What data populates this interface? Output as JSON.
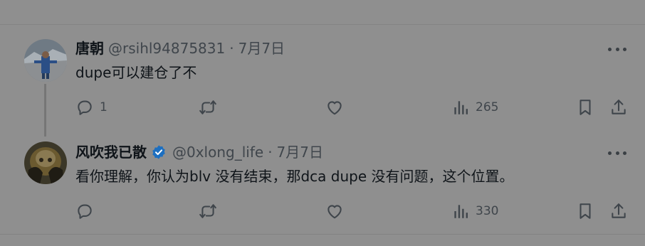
{
  "tweets": [
    {
      "name": "唐朝",
      "handle": "@rsihl94875831",
      "separator": "·",
      "date": "7月7日",
      "text": "dupe可以建仓了不",
      "replies": "1",
      "retweets": "",
      "likes": "",
      "views": "265",
      "verified": false
    },
    {
      "name": "风吹我已散",
      "handle": "@0xlong_life",
      "separator": "·",
      "date": "7月7日",
      "text": "看你理解，你认为blv 没有结束，那dca dupe 没有问题，这个位置。",
      "replies": "",
      "retweets": "",
      "likes": "",
      "views": "330",
      "verified": true
    }
  ],
  "icons": {
    "reply": "reply-icon",
    "retweet": "retweet-icon",
    "like": "heart-icon",
    "views": "views-chart-icon",
    "bookmark": "bookmark-icon",
    "share": "share-icon",
    "more": "more-icon",
    "verified": "verified-badge-icon"
  },
  "colors": {
    "background": "#8f8f8f",
    "verified_badge": "#1d6fc0",
    "text": "#0f1419",
    "muted": "#40464c"
  }
}
